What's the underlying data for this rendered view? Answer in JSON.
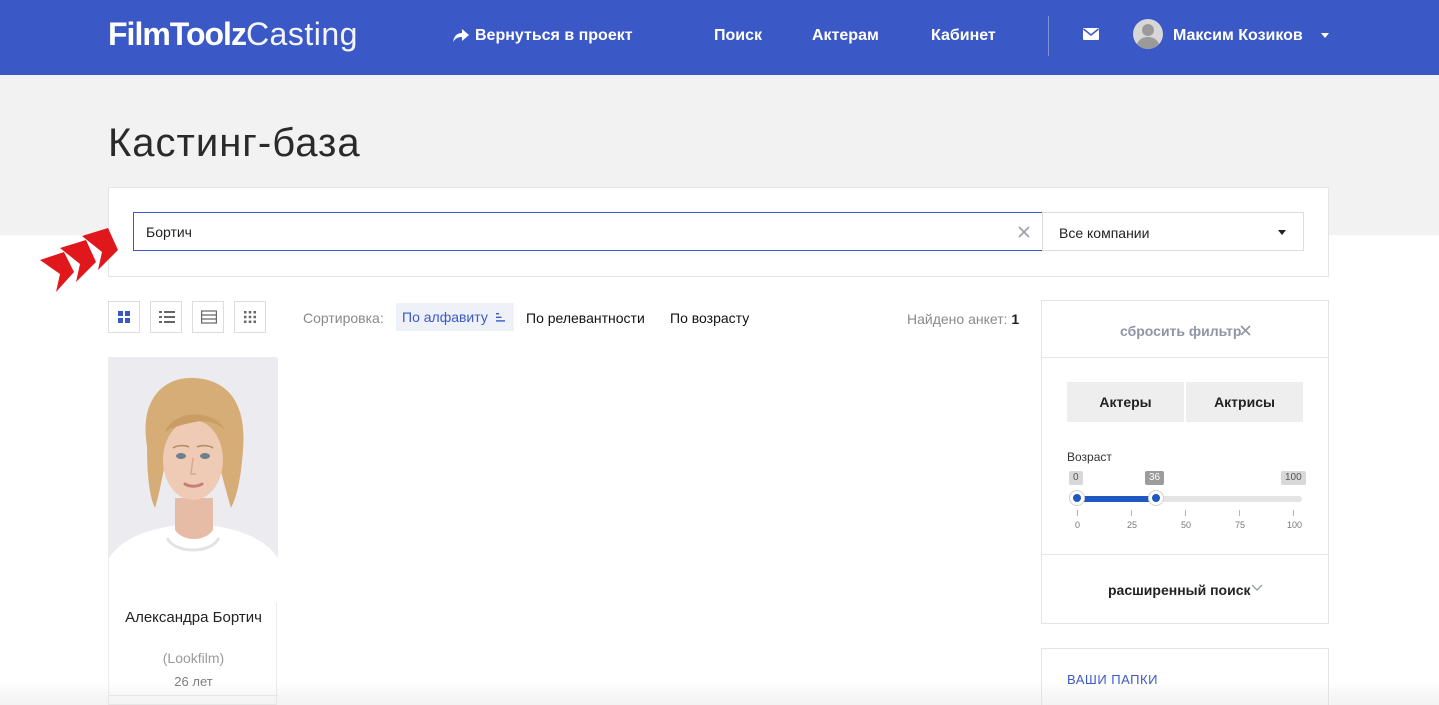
{
  "header": {
    "logo_bold": "FilmToolz",
    "logo_light": "Casting",
    "nav_back": "Вернуться в проект",
    "nav_search": "Поиск",
    "nav_actors": "Актерам",
    "nav_cabinet": "Кабинет",
    "user_name": "Максим Козиков"
  },
  "page": {
    "title": "Кастинг-база"
  },
  "search": {
    "query": "Бортич",
    "company_select": "Все компании"
  },
  "toolbar": {
    "sort_label": "Сортировка:",
    "sort_alpha": "По алфавиту",
    "sort_relevance": "По релевантности",
    "sort_age": "По возрасту",
    "found_label": "Найдено анкет:",
    "found_count": "1"
  },
  "results": [
    {
      "name": "Александра Бортич",
      "company": "(Lookfilm)",
      "age": "26 лет"
    }
  ],
  "filter": {
    "reset": "сбросить фильтр",
    "gender_actors": "Актеры",
    "gender_actresses": "Актрисы",
    "age_label": "Возраст",
    "age_min": "0",
    "age_value": "36",
    "age_max": "100",
    "age_ticks": [
      "0",
      "25",
      "50",
      "75",
      "100"
    ],
    "advanced": "расширенный поиск"
  },
  "folders": {
    "title": "ВАШИ ПАПКИ"
  },
  "colors": {
    "brand": "#3a59c7",
    "slider": "#1f57c3",
    "arrows": "#e0171b"
  }
}
